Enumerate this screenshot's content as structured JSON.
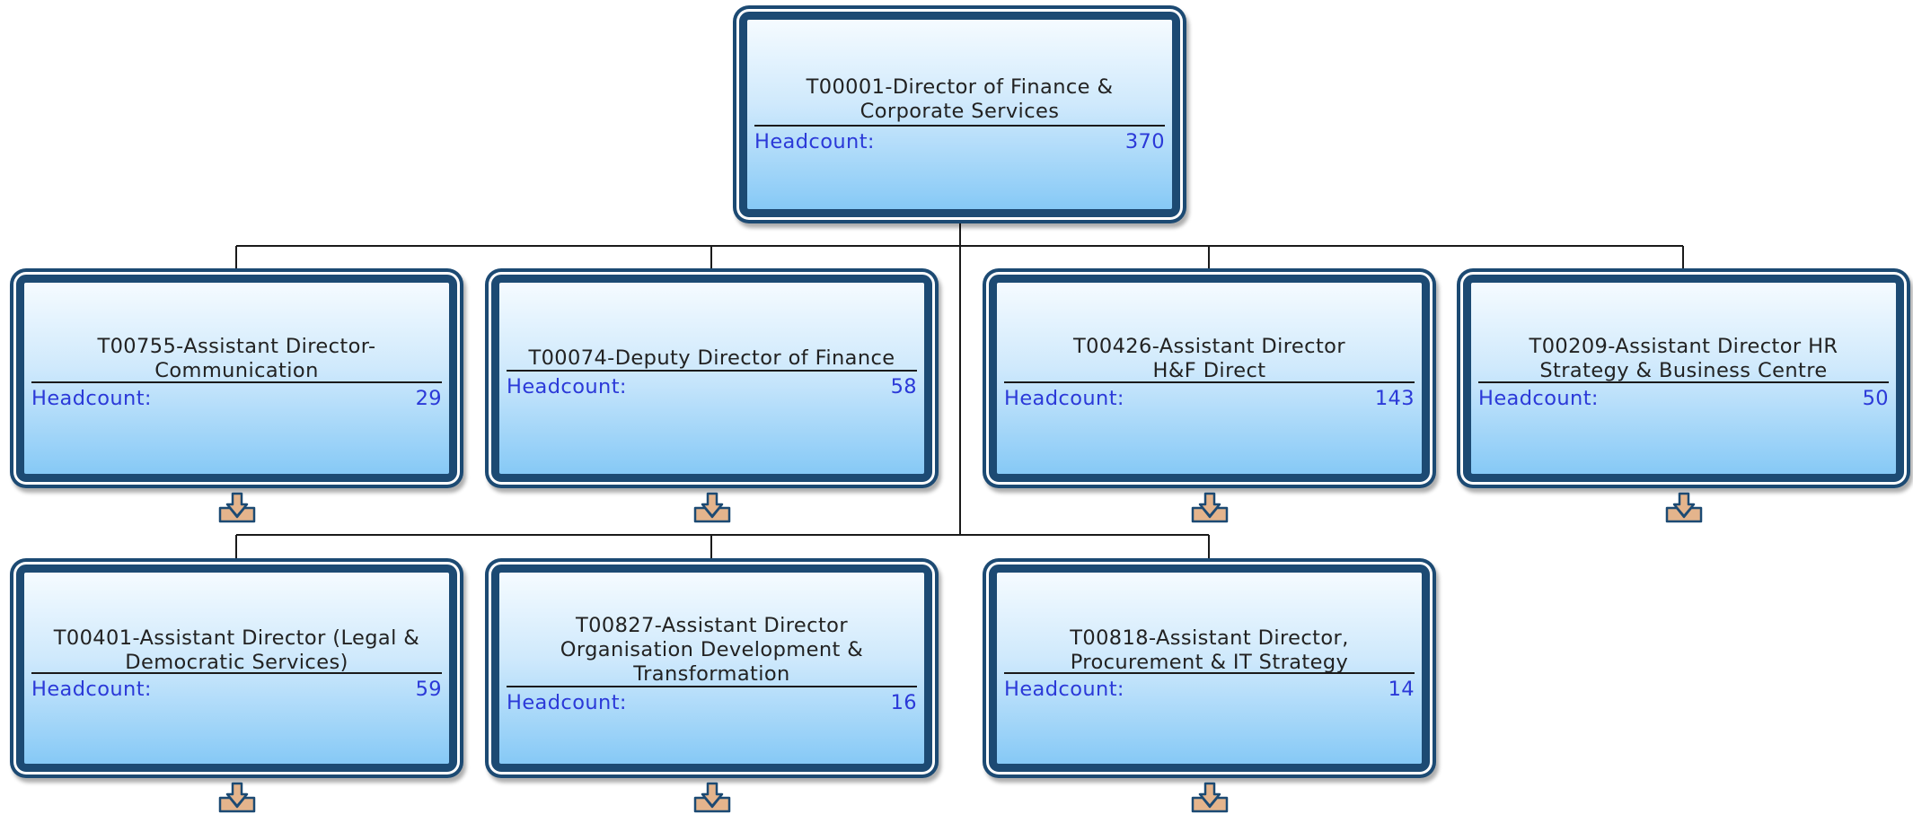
{
  "headcount_label": "Headcount:",
  "colors": {
    "frame": "#1c4a73",
    "headcount_text": "#2b39d8",
    "gradient_top": "#f5fbff",
    "gradient_bottom": "#86c9f6",
    "expand_fill": "#e4b48c"
  },
  "root": {
    "id": "T00001",
    "title": "T00001-Director of Finance & Corporate Services",
    "headcount": "370"
  },
  "children": [
    {
      "id": "T00755",
      "title": "T00755-Assistant Director-Communication",
      "headcount": "29",
      "expand_icon": "expand-down-arrow-icon"
    },
    {
      "id": "T00074",
      "title": "T00074-Deputy Director of Finance",
      "headcount": "58",
      "expand_icon": "expand-down-arrow-icon"
    },
    {
      "id": "T00426",
      "title": "T00426-Assistant Director H&F Direct",
      "headcount": "143",
      "expand_icon": "expand-down-arrow-icon"
    },
    {
      "id": "T00209",
      "title": "T00209-Assistant Director HR Strategy & Business Centre",
      "headcount": "50",
      "expand_icon": "expand-down-arrow-icon"
    },
    {
      "id": "T00401",
      "title": "T00401-Assistant Director (Legal & Democratic Services)",
      "headcount": "59",
      "expand_icon": "expand-down-arrow-icon"
    },
    {
      "id": "T00827",
      "title": "T00827-Assistant Director Organisation Development & Transformation",
      "headcount": "16",
      "expand_icon": "expand-down-arrow-icon"
    },
    {
      "id": "T00818",
      "title": "T00818-Assistant Director, Procurement & IT Strategy",
      "headcount": "14",
      "expand_icon": "expand-down-arrow-icon"
    }
  ]
}
